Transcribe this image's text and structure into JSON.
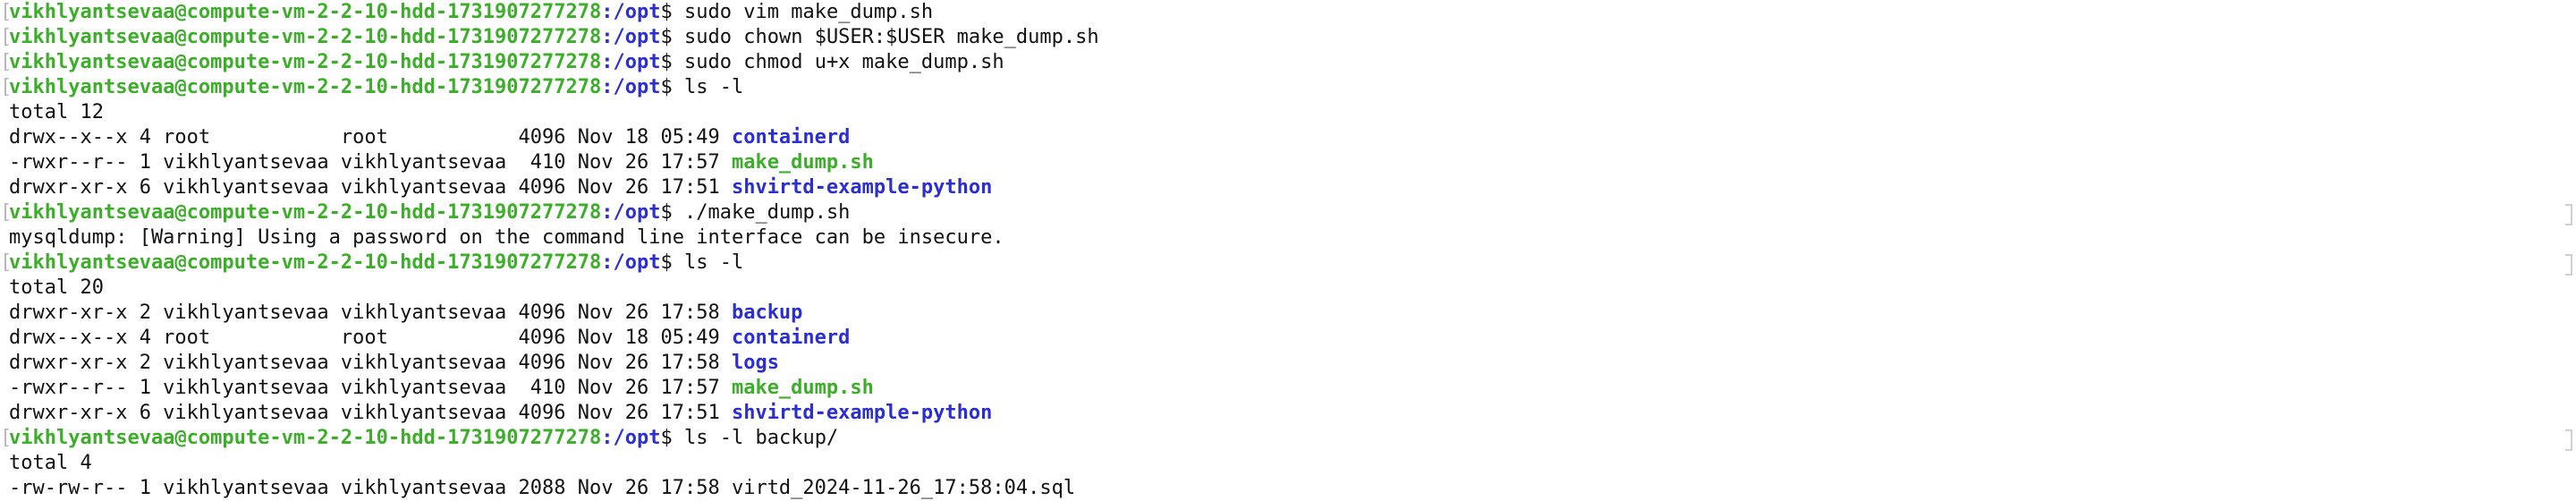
{
  "terminal": {
    "prompt": {
      "user_host": "vikhlyantsevaa@compute-vm-2-2-10-hdd-1731907277278",
      "colon": ":",
      "path": "/opt",
      "symbol": "$ "
    },
    "lines": [
      {
        "kind": "prompt",
        "cmd": "sudo vim make_dump.sh"
      },
      {
        "kind": "prompt",
        "cmd": "sudo chown $USER:$USER make_dump.sh"
      },
      {
        "kind": "prompt",
        "cmd": "sudo chmod u+x make_dump.sh"
      },
      {
        "kind": "prompt",
        "cmd": "ls -l"
      },
      {
        "kind": "text",
        "text": "total 12"
      },
      {
        "kind": "entry",
        "meta": "drwx--x--x 4 root           root           4096 Nov 18 05:49 ",
        "name": "containerd",
        "type": "dir"
      },
      {
        "kind": "entry",
        "meta": "-rwxr--r-- 1 vikhlyantsevaa vikhlyantsevaa  410 Nov 26 17:57 ",
        "name": "make_dump.sh",
        "type": "exec"
      },
      {
        "kind": "entry",
        "meta": "drwxr-xr-x 6 vikhlyantsevaa vikhlyantsevaa 4096 Nov 26 17:51 ",
        "name": "shvirtd-example-python",
        "type": "dir"
      },
      {
        "kind": "prompt",
        "cmd": "./make_dump.sh"
      },
      {
        "kind": "text",
        "text": "mysqldump: [Warning] Using a password on the command line interface can be insecure."
      },
      {
        "kind": "prompt",
        "cmd": "ls -l"
      },
      {
        "kind": "text",
        "text": "total 20"
      },
      {
        "kind": "entry",
        "meta": "drwxr-xr-x 2 vikhlyantsevaa vikhlyantsevaa 4096 Nov 26 17:58 ",
        "name": "backup",
        "type": "dir"
      },
      {
        "kind": "entry",
        "meta": "drwx--x--x 4 root           root           4096 Nov 18 05:49 ",
        "name": "containerd",
        "type": "dir"
      },
      {
        "kind": "entry",
        "meta": "drwxr-xr-x 2 vikhlyantsevaa vikhlyantsevaa 4096 Nov 26 17:58 ",
        "name": "logs",
        "type": "dir"
      },
      {
        "kind": "entry",
        "meta": "-rwxr--r-- 1 vikhlyantsevaa vikhlyantsevaa  410 Nov 26 17:57 ",
        "name": "make_dump.sh",
        "type": "exec"
      },
      {
        "kind": "entry",
        "meta": "drwxr-xr-x 6 vikhlyantsevaa vikhlyantsevaa 4096 Nov 26 17:51 ",
        "name": "shvirtd-example-python",
        "type": "dir"
      },
      {
        "kind": "prompt",
        "cmd": "ls -l backup/"
      },
      {
        "kind": "text",
        "text": "total 4"
      },
      {
        "kind": "text",
        "text": "-rw-rw-r-- 1 vikhlyantsevaa vikhlyantsevaa 2088 Nov 26 17:58 virtd_2024-11-26_17:58:04.sql"
      }
    ]
  },
  "colors": {
    "user_host": "#3cae2a",
    "path": "#2b2fd1",
    "directory": "#2b2fd1",
    "executable": "#3cae2a",
    "text": "#111111",
    "background": "#ffffff"
  }
}
